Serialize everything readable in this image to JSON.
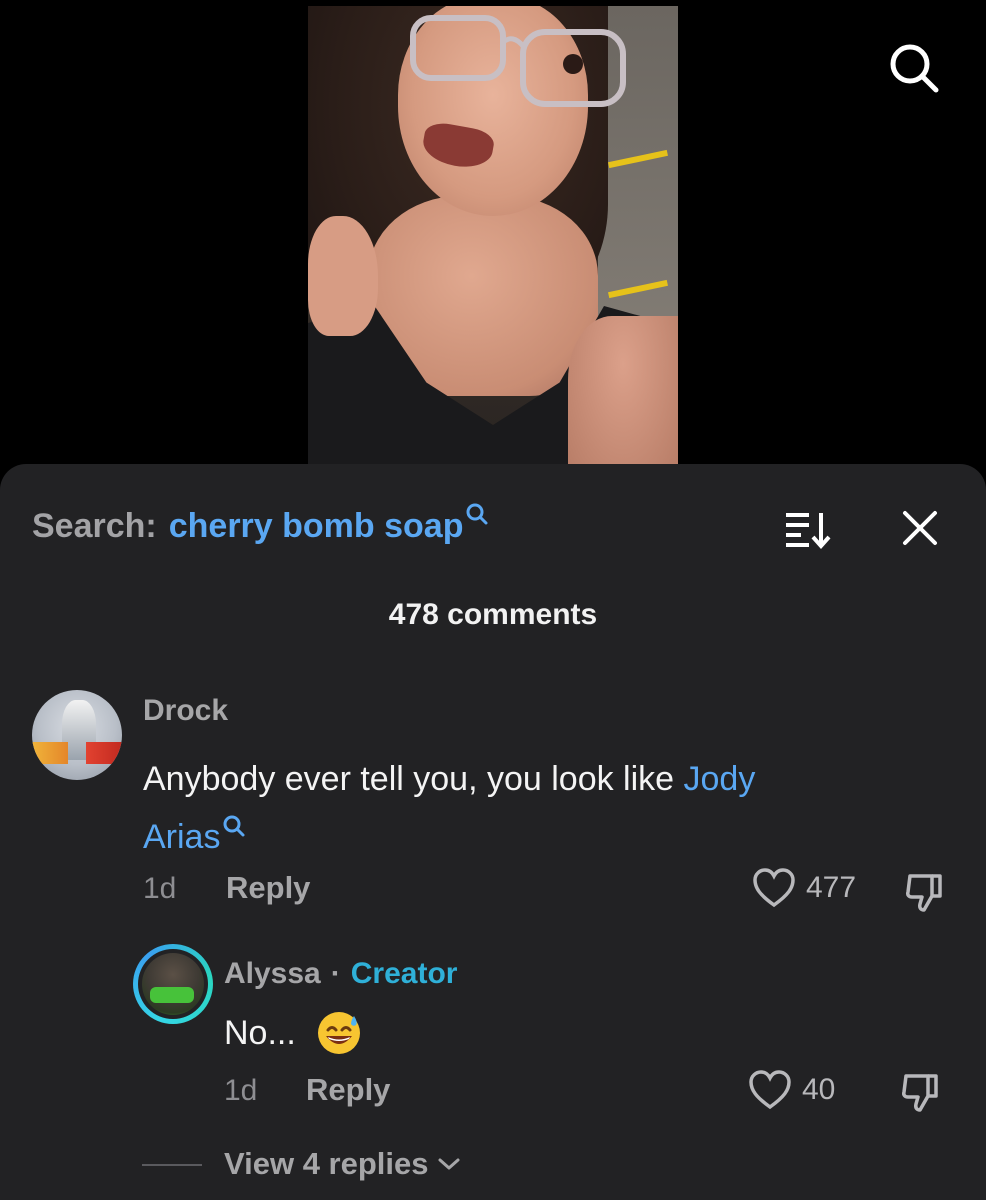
{
  "search": {
    "prefix": "Search:",
    "query": "cherry bomb soap"
  },
  "comments_header": {
    "count_text": "478 comments"
  },
  "comment": {
    "author": "Drock",
    "text": "Anybody ever tell you, you look like ",
    "linked_text_line1": "Jody",
    "linked_text_line2": "Arias",
    "time": "1d",
    "reply_label": "Reply",
    "likes": "477"
  },
  "reply": {
    "author": "Alyssa",
    "separator": "·",
    "badge": "Creator",
    "text": "No...",
    "emoji": "sweat-smile-emoji",
    "time": "1d",
    "reply_label": "Reply",
    "likes": "40"
  },
  "view_replies": {
    "label": "View 4 replies"
  },
  "colors": {
    "sheet_bg": "#222224",
    "link_blue": "#5aa7f2",
    "creator_teal": "#2fb0d8",
    "muted_text": "#a6a6a8"
  }
}
